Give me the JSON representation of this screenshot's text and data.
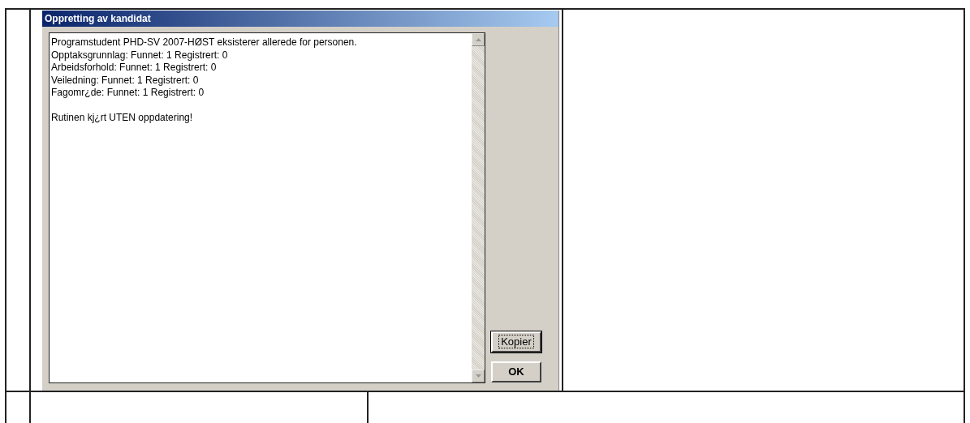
{
  "dialog": {
    "title": "Oppretting av kandidat",
    "message_paragraphs": [
      [
        "Programstudent PHD-SV 2007-HØST eksisterer allerede for personen.",
        "Opptaksgrunnlag: Funnet: 1 Registrert: 0",
        "Arbeidsforhold: Funnet: 1 Registrert: 0",
        "Veiledning: Funnet: 1 Registrert: 0",
        "Fagomr¿de: Funnet: 1 Registrert: 0"
      ],
      [
        "Rutinen kj¿rt UTEN oppdatering!"
      ]
    ],
    "buttons": [
      {
        "label": "Kopier",
        "focused": true
      },
      {
        "label": "OK",
        "focused": false
      }
    ]
  }
}
